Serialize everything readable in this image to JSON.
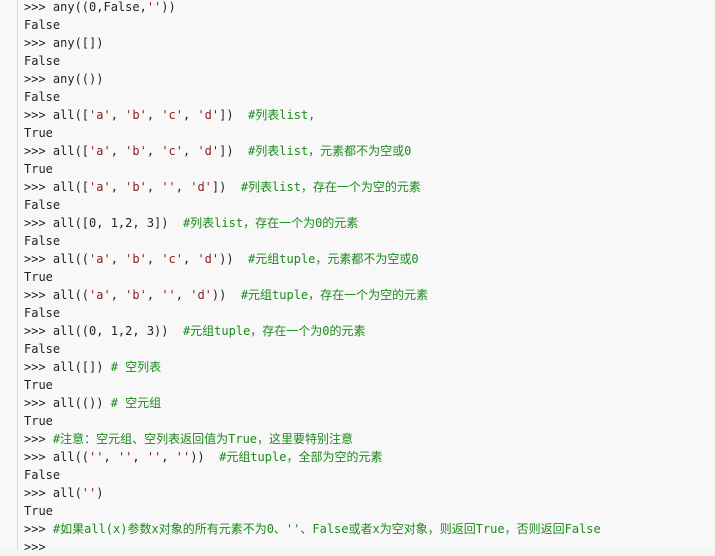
{
  "lines": [
    [
      {
        "t": ">>> any((0,False,"
      },
      {
        "t": "''",
        "c": "str"
      },
      {
        "t": "))"
      }
    ],
    [
      {
        "t": "False"
      }
    ],
    [
      {
        "t": ">>> any([])"
      }
    ],
    [
      {
        "t": "False"
      }
    ],
    [
      {
        "t": ">>> any(())"
      }
    ],
    [
      {
        "t": "False"
      }
    ],
    [
      {
        "t": ">>> all(["
      },
      {
        "t": "'a'",
        "c": "str"
      },
      {
        "t": ", "
      },
      {
        "t": "'b'",
        "c": "str"
      },
      {
        "t": ", "
      },
      {
        "t": "'c'",
        "c": "str"
      },
      {
        "t": ", "
      },
      {
        "t": "'d'",
        "c": "str"
      },
      {
        "t": "])  "
      },
      {
        "t": "#列表list,",
        "c": "cm"
      }
    ],
    [
      {
        "t": "True"
      }
    ],
    [
      {
        "t": ">>> all(["
      },
      {
        "t": "'a'",
        "c": "str"
      },
      {
        "t": ", "
      },
      {
        "t": "'b'",
        "c": "str"
      },
      {
        "t": ", "
      },
      {
        "t": "'c'",
        "c": "str"
      },
      {
        "t": ", "
      },
      {
        "t": "'d'",
        "c": "str"
      },
      {
        "t": "])  "
      },
      {
        "t": "#列表list，元素都不为空或0",
        "c": "cm"
      }
    ],
    [
      {
        "t": "True"
      }
    ],
    [
      {
        "t": ">>> all(["
      },
      {
        "t": "'a'",
        "c": "str"
      },
      {
        "t": ", "
      },
      {
        "t": "'b'",
        "c": "str"
      },
      {
        "t": ", "
      },
      {
        "t": "''",
        "c": "str"
      },
      {
        "t": ", "
      },
      {
        "t": "'d'",
        "c": "str"
      },
      {
        "t": "])  "
      },
      {
        "t": "#列表list，存在一个为空的元素",
        "c": "cm"
      }
    ],
    [
      {
        "t": "False"
      }
    ],
    [
      {
        "t": ">>> all([0, 1,2, 3])  "
      },
      {
        "t": "#列表list，存在一个为0的元素",
        "c": "cm"
      }
    ],
    [
      {
        "t": "False"
      }
    ],
    [
      {
        "t": ">>> all(("
      },
      {
        "t": "'a'",
        "c": "str"
      },
      {
        "t": ", "
      },
      {
        "t": "'b'",
        "c": "str"
      },
      {
        "t": ", "
      },
      {
        "t": "'c'",
        "c": "str"
      },
      {
        "t": ", "
      },
      {
        "t": "'d'",
        "c": "str"
      },
      {
        "t": "))  "
      },
      {
        "t": "#元组tuple，元素都不为空或0",
        "c": "cm"
      }
    ],
    [
      {
        "t": "True"
      }
    ],
    [
      {
        "t": ">>> all(("
      },
      {
        "t": "'a'",
        "c": "str"
      },
      {
        "t": ", "
      },
      {
        "t": "'b'",
        "c": "str"
      },
      {
        "t": ", "
      },
      {
        "t": "''",
        "c": "str"
      },
      {
        "t": ", "
      },
      {
        "t": "'d'",
        "c": "str"
      },
      {
        "t": "))  "
      },
      {
        "t": "#元组tuple，存在一个为空的元素",
        "c": "cm"
      }
    ],
    [
      {
        "t": "False"
      }
    ],
    [
      {
        "t": ">>> all((0, 1,2, 3))  "
      },
      {
        "t": "#元组tuple，存在一个为0的元素",
        "c": "cm"
      }
    ],
    [
      {
        "t": "False"
      }
    ],
    [
      {
        "t": ">>> all([]) "
      },
      {
        "t": "# 空列表",
        "c": "cm"
      }
    ],
    [
      {
        "t": "True"
      }
    ],
    [
      {
        "t": ">>> all(()) "
      },
      {
        "t": "# 空元组",
        "c": "cm"
      }
    ],
    [
      {
        "t": "True"
      }
    ],
    [
      {
        "t": ">>> "
      },
      {
        "t": "#注意：空元组、空列表返回值为True，这里要特别注意",
        "c": "cm"
      }
    ],
    [
      {
        "t": ">>> all(("
      },
      {
        "t": "''",
        "c": "str"
      },
      {
        "t": ", "
      },
      {
        "t": "''",
        "c": "str"
      },
      {
        "t": ", "
      },
      {
        "t": "''",
        "c": "str"
      },
      {
        "t": ", "
      },
      {
        "t": "''",
        "c": "str"
      },
      {
        "t": "))  "
      },
      {
        "t": "#元组tuple，全部为空的元素",
        "c": "cm"
      }
    ],
    [
      {
        "t": "False"
      }
    ],
    [
      {
        "t": ">>> all("
      },
      {
        "t": "''",
        "c": "str"
      },
      {
        "t": ")"
      }
    ],
    [
      {
        "t": "True"
      }
    ],
    [
      {
        "t": ">>> "
      },
      {
        "t": "#如果all(x)参数x对象的所有元素不为0、''、False或者x为空对象，则返回True，否则返回False",
        "c": "cm"
      }
    ],
    [
      {
        "t": ">>>"
      }
    ]
  ]
}
